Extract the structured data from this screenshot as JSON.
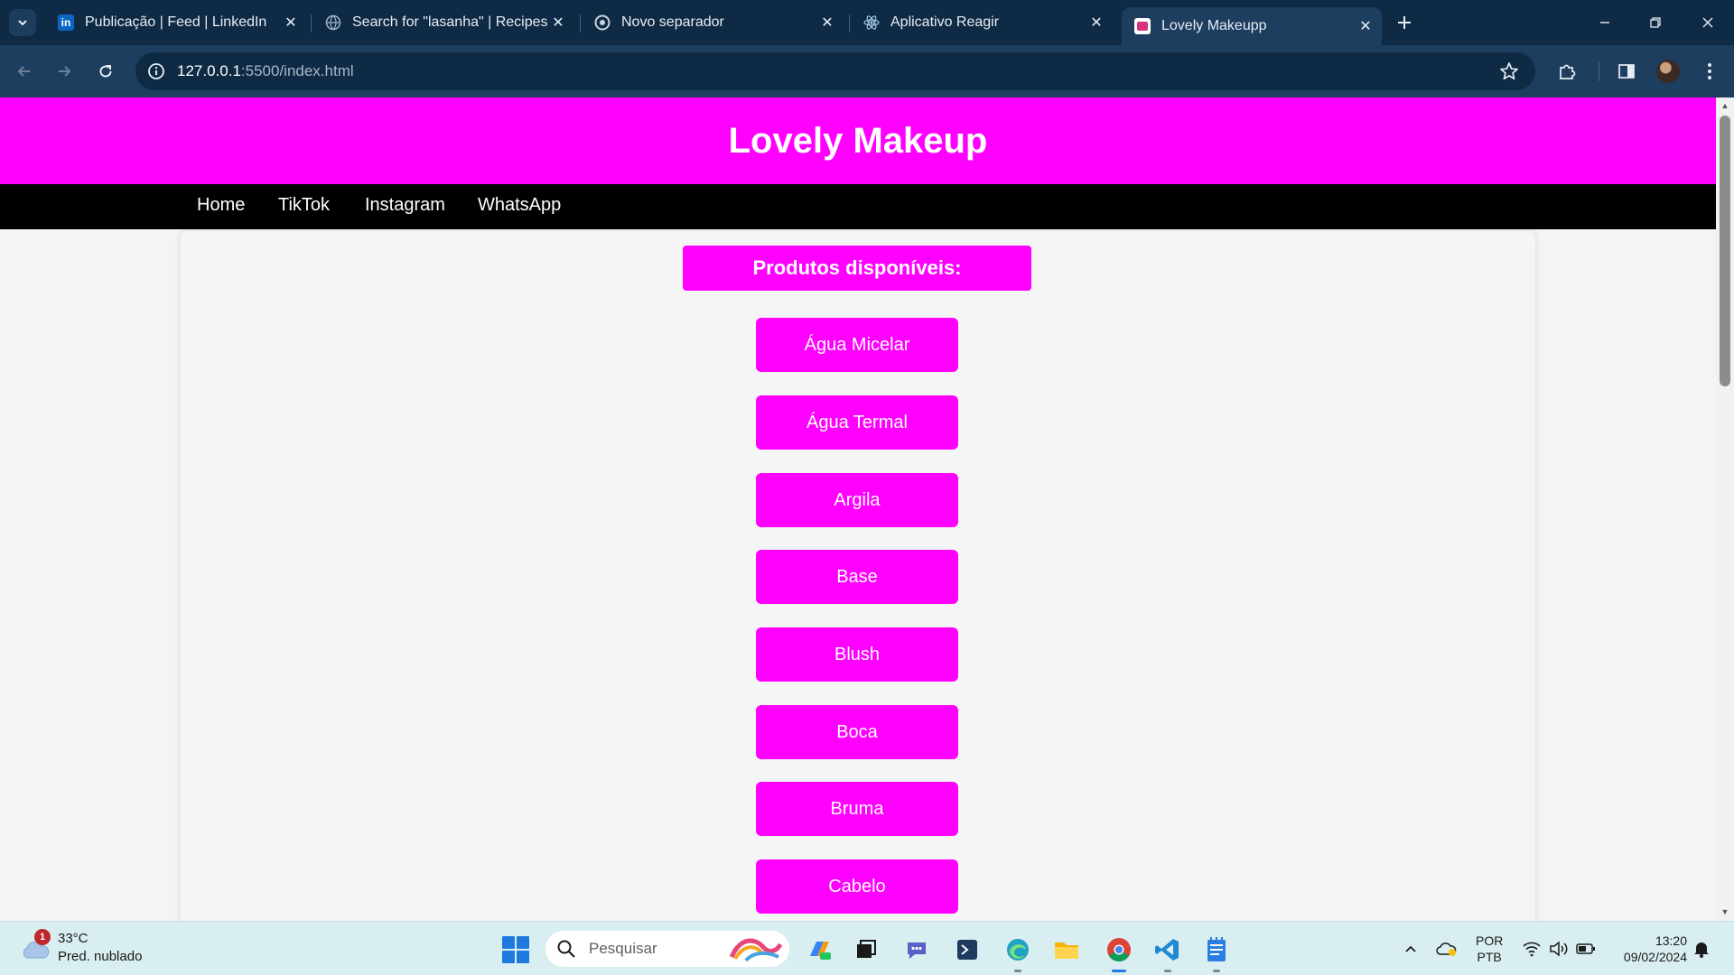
{
  "browser": {
    "tabs": [
      {
        "title": "Publicação | Feed | LinkedIn",
        "favicon": "linkedin-icon"
      },
      {
        "title": "Search for \"lasanha\" | Recipes",
        "favicon": "globe-icon"
      },
      {
        "title": "Novo separador",
        "favicon": "chrome-icon"
      },
      {
        "title": "Aplicativo Reagir",
        "favicon": "react-icon"
      },
      {
        "title": "Lovely Makeupp",
        "favicon": "site-icon"
      }
    ],
    "active_tab": 4,
    "url_host": "127.0.0.1",
    "url_rest": ":5500/index.html"
  },
  "site": {
    "title": "Lovely Makeup",
    "nav": [
      "Home",
      "TikTok",
      "Instagram",
      "WhatsApp"
    ],
    "products_heading": "Produtos disponíveis:",
    "products": [
      "Água Micelar",
      "Água Termal",
      "Argila",
      "Base",
      "Blush",
      "Boca",
      "Bruma",
      "Cabelo"
    ]
  },
  "taskbar": {
    "weather_temp": "33°C",
    "weather_cond": "Pred. nublado",
    "weather_badge": "1",
    "search_placeholder": "Pesquisar",
    "lang_1": "POR",
    "lang_2": "PTB",
    "time": "13:20",
    "date": "09/02/2024"
  },
  "colors": {
    "brand": "#ff00ff",
    "nav_bg": "#000000",
    "chrome_tabbar": "#0f2a44",
    "chrome_toolbar": "#1e3e60"
  }
}
